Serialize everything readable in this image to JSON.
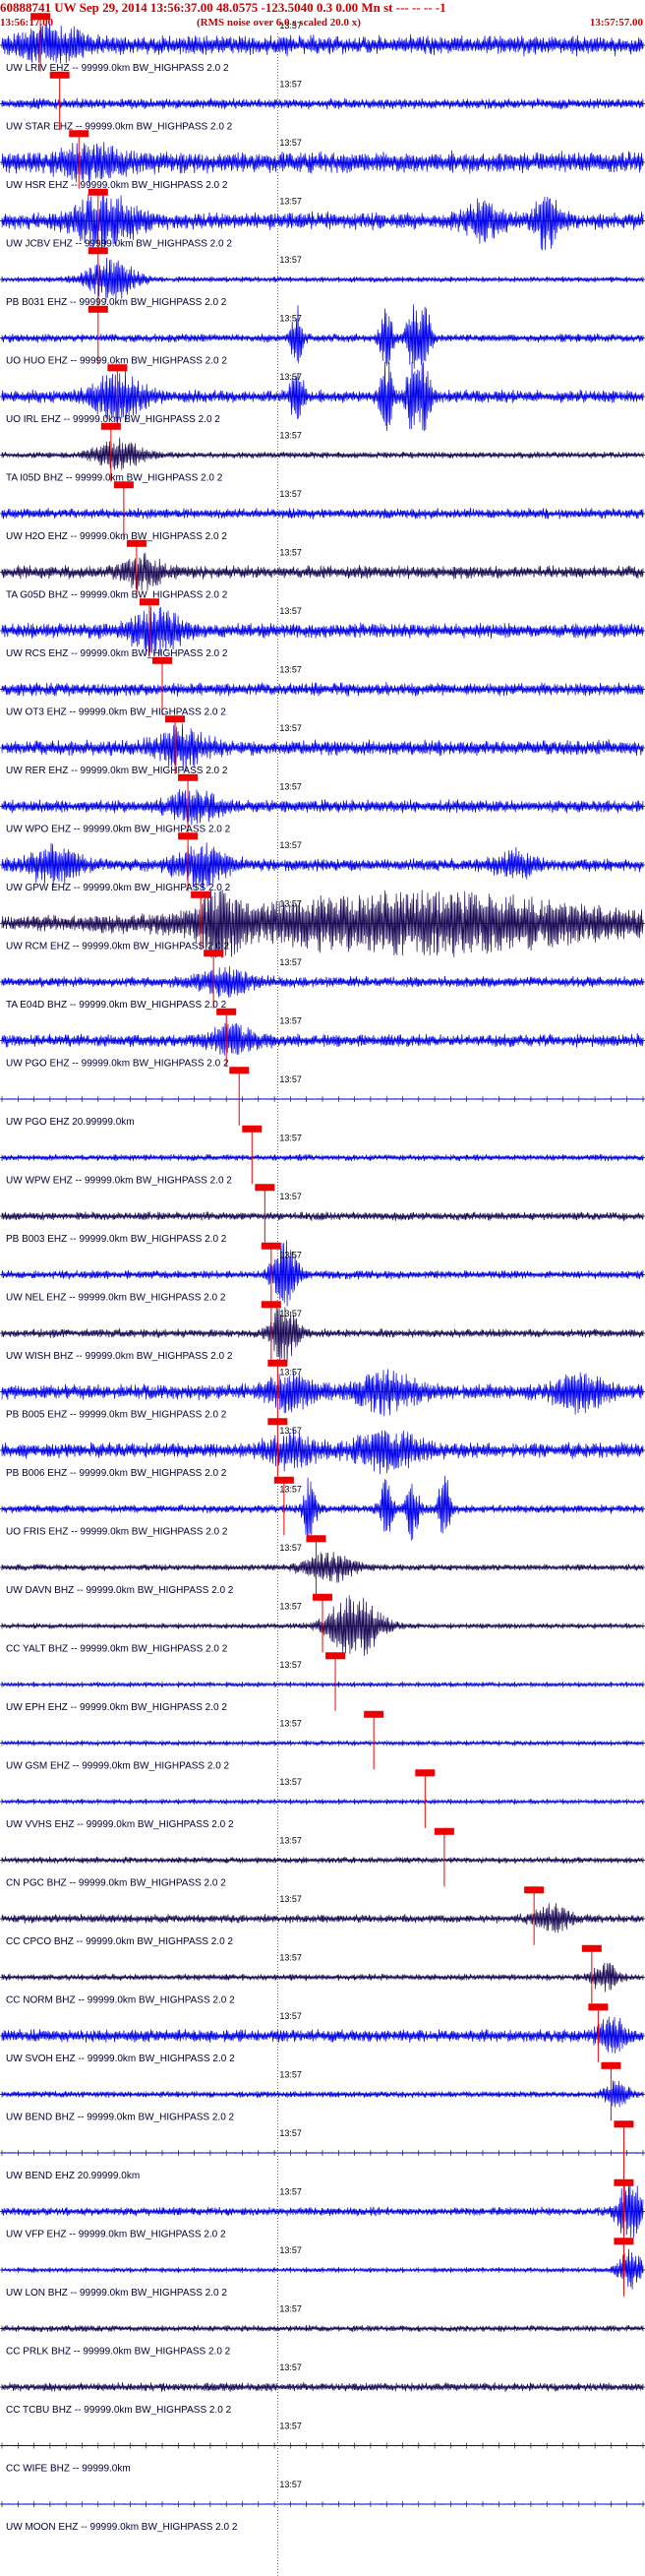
{
  "header": {
    "title": "60888741 UW Sep 29, 2014 13:56:37.00   48.0575 -123.5040  0.3 0.00 Mn st --- -- -- -1",
    "start_time": "13:56:17.00",
    "end_time": "13:57:57.00",
    "note": "(RMS noise over 6.0 s scaled 20.0 x)"
  },
  "colors": {
    "blue": "#0000ee",
    "dark": "#1a0a55",
    "red": "#ee0000"
  },
  "chart_data": {
    "type": "line",
    "title": "60888741 UW Sep 29, 2014 13:56:37.00   48.0575 -123.5040  0.3 0.00 Mn st --- -- -- -1",
    "x_start": "13:56:17.00",
    "x_end": "13:57:57.00",
    "minute_mark": "13:57",
    "traces": [
      {
        "label": "UW LRIV EHZ -- 99999.0km BW_HIGHPASS 2.0 2",
        "color": "blue",
        "amp": 0.45,
        "pick": 0.06,
        "events": [
          [
            0.08,
            0.6,
            0.05
          ]
        ]
      },
      {
        "label": "UW STAR EHZ -- 99999.0km BW_HIGHPASS 2.0 2",
        "color": "blue",
        "amp": 0.25,
        "pick": 0.09,
        "events": []
      },
      {
        "label": "UW HSR EHZ -- 99999.0km BW_HIGHPASS 2.0 2",
        "color": "blue",
        "amp": 0.5,
        "pick": 0.12,
        "events": [
          [
            0.14,
            0.5,
            0.05
          ]
        ]
      },
      {
        "label": "UW JCBV EHZ -- 99999.0km BW_HIGHPASS 2.0 2",
        "color": "blue",
        "amp": 0.4,
        "pick": 0.15,
        "events": [
          [
            0.16,
            0.9,
            0.05
          ],
          [
            0.75,
            0.7,
            0.03
          ],
          [
            0.85,
            1.0,
            0.02
          ]
        ]
      },
      {
        "label": "PB B031 EHZ -- 99999.0km BW_HIGHPASS 2.0 2",
        "color": "blue",
        "amp": 0.12,
        "pick": 0.15,
        "events": [
          [
            0.17,
            0.8,
            0.04
          ]
        ]
      },
      {
        "label": "UO HUO EHZ -- 99999.0km BW_HIGHPASS 2.0 2",
        "color": "blue",
        "amp": 0.2,
        "pick": 0.15,
        "events": [
          [
            0.46,
            1.2,
            0.01
          ],
          [
            0.6,
            1.2,
            0.01
          ],
          [
            0.64,
            1.2,
            0.01
          ],
          [
            0.66,
            1.2,
            0.01
          ]
        ]
      },
      {
        "label": "UO IRL EHZ -- 99999.0km BW_HIGHPASS 2.0 2",
        "color": "blue",
        "amp": 0.3,
        "pick": 0.18,
        "events": [
          [
            0.18,
            0.9,
            0.04
          ],
          [
            0.46,
            1.4,
            0.01
          ],
          [
            0.6,
            1.4,
            0.01
          ],
          [
            0.64,
            1.4,
            0.01
          ],
          [
            0.66,
            1.4,
            0.01
          ]
        ]
      },
      {
        "label": "TA I05D BHZ -- 99999.0km BW_HIGHPASS 2.0 2",
        "color": "dark",
        "amp": 0.15,
        "pick": 0.17,
        "events": [
          [
            0.18,
            0.6,
            0.04
          ]
        ]
      },
      {
        "label": "UW H2O EHZ -- 99999.0km BW_HIGHPASS 2.0 2",
        "color": "blue",
        "amp": 0.25,
        "pick": 0.19,
        "events": []
      },
      {
        "label": "TA G05D BHZ -- 99999.0km BW_HIGHPASS 2.0 2",
        "color": "dark",
        "amp": 0.3,
        "pick": 0.21,
        "events": [
          [
            0.22,
            0.6,
            0.03
          ]
        ]
      },
      {
        "label": "UW RCS EHZ -- 99999.0km BW_HIGHPASS 2.0 2",
        "color": "blue",
        "amp": 0.35,
        "pick": 0.23,
        "events": [
          [
            0.24,
            0.8,
            0.04
          ]
        ]
      },
      {
        "label": "UW OT3 EHZ -- 99999.0km BW_HIGHPASS 2.0 2",
        "color": "blue",
        "amp": 0.3,
        "pick": 0.25,
        "events": []
      },
      {
        "label": "UW RER EHZ -- 99999.0km BW_HIGHPASS 2.0 2",
        "color": "blue",
        "amp": 0.35,
        "pick": 0.27,
        "events": [
          [
            0.28,
            0.7,
            0.04
          ]
        ]
      },
      {
        "label": "UW WPO EHZ -- 99999.0km BW_HIGHPASS 2.0 2",
        "color": "blue",
        "amp": 0.3,
        "pick": 0.29,
        "events": [
          [
            0.3,
            0.6,
            0.04
          ]
        ]
      },
      {
        "label": "UW GPW EHZ -- 99999.0km BW_HIGHPASS 2.0 2",
        "color": "blue",
        "amp": 0.3,
        "pick": 0.29,
        "events": [
          [
            0.31,
            0.8,
            0.04
          ],
          [
            0.08,
            0.7,
            0.04
          ],
          [
            0.8,
            0.5,
            0.03
          ]
        ]
      },
      {
        "label": "UW RCM EHZ -- 99999.0km BW_HIGHPASS 2.0 2",
        "color": "dark",
        "amp": 0.35,
        "pick": 0.31,
        "events": [
          [
            0.34,
            1.2,
            0.03
          ],
          [
            0.65,
            1.1,
            0.3
          ]
        ]
      },
      {
        "label": "TA E04D BHZ -- 99999.0km BW_HIGHPASS 2.0 2",
        "color": "blue",
        "amp": 0.25,
        "pick": 0.33,
        "events": [
          [
            0.35,
            0.5,
            0.04
          ]
        ]
      },
      {
        "label": "UW PGO EHZ -- 99999.0km BW_HIGHPASS 2.0 2",
        "color": "blue",
        "amp": 0.3,
        "pick": 0.35,
        "events": [
          [
            0.36,
            0.5,
            0.04
          ]
        ]
      },
      {
        "label": "UW PGO EHZ 20.99999.0km",
        "color": "blue",
        "amp": 0.02,
        "pick": 0.37,
        "events": []
      },
      {
        "label": "UW WPW EHZ -- 99999.0km BW_HIGHPASS 2.0 2",
        "color": "blue",
        "amp": 0.15,
        "pick": 0.39,
        "events": []
      },
      {
        "label": "PB B003 EHZ -- 99999.0km BW_HIGHPASS 2.0 2",
        "color": "dark",
        "amp": 0.2,
        "pick": 0.41,
        "events": []
      },
      {
        "label": "UW NEL EHZ -- 99999.0km BW_HIGHPASS 2.0 2",
        "color": "blue",
        "amp": 0.2,
        "pick": 0.42,
        "events": [
          [
            0.44,
            1.3,
            0.02
          ]
        ]
      },
      {
        "label": "UW WISH BHZ -- 99999.0km BW_HIGHPASS 2.0 2",
        "color": "dark",
        "amp": 0.2,
        "pick": 0.42,
        "events": [
          [
            0.44,
            1.3,
            0.02
          ]
        ]
      },
      {
        "label": "PB B005 EHZ -- 99999.0km BW_HIGHPASS 2.0 2",
        "color": "blue",
        "amp": 0.35,
        "pick": 0.43,
        "events": [
          [
            0.45,
            0.6,
            0.04
          ],
          [
            0.6,
            0.7,
            0.05
          ],
          [
            0.9,
            0.6,
            0.04
          ]
        ]
      },
      {
        "label": "PB B006 EHZ -- 99999.0km BW_HIGHPASS 2.0 2",
        "color": "blue",
        "amp": 0.35,
        "pick": 0.43,
        "events": [
          [
            0.45,
            0.6,
            0.04
          ],
          [
            0.6,
            0.7,
            0.05
          ]
        ]
      },
      {
        "label": "UO FRIS EHZ -- 99999.0km BW_HIGHPASS 2.0 2",
        "color": "blue",
        "amp": 0.2,
        "pick": 0.44,
        "events": [
          [
            0.48,
            1.3,
            0.01
          ],
          [
            0.6,
            1.3,
            0.01
          ],
          [
            0.64,
            1.3,
            0.01
          ],
          [
            0.69,
            1.3,
            0.01
          ]
        ]
      },
      {
        "label": "UW DAVN BHZ -- 99999.0km BW_HIGHPASS 2.0 2",
        "color": "dark",
        "amp": 0.15,
        "pick": 0.49,
        "events": [
          [
            0.51,
            0.6,
            0.04
          ]
        ]
      },
      {
        "label": "CC YALT BHZ -- 99999.0km BW_HIGHPASS 2.0 2",
        "color": "dark",
        "amp": 0.12,
        "pick": 0.5,
        "events": [
          [
            0.55,
            1.4,
            0.04
          ]
        ]
      },
      {
        "label": "UW EPH EHZ -- 99999.0km BW_HIGHPASS 2.0 2",
        "color": "blue",
        "amp": 0.1,
        "pick": 0.52,
        "events": []
      },
      {
        "label": "UW GSM EHZ -- 99999.0km BW_HIGHPASS 2.0 2",
        "color": "blue",
        "amp": 0.1,
        "pick": 0.58,
        "events": []
      },
      {
        "label": "UW VVHS EHZ -- 99999.0km BW_HIGHPASS 2.0 2",
        "color": "blue",
        "amp": 0.1,
        "pick": 0.66,
        "events": []
      },
      {
        "label": "CN PGC BHZ -- 99999.0km BW_HIGHPASS 2.0 2",
        "color": "dark",
        "amp": 0.15,
        "pick": 0.69,
        "events": []
      },
      {
        "label": "CC CPCO BHZ -- 99999.0km BW_HIGHPASS 2.0 2",
        "color": "dark",
        "amp": 0.2,
        "pick": 0.83,
        "events": [
          [
            0.86,
            0.5,
            0.03
          ]
        ]
      },
      {
        "label": "CC NORM BHZ -- 99999.0km BW_HIGHPASS 2.0 2",
        "color": "dark",
        "amp": 0.15,
        "pick": 0.92,
        "events": [
          [
            0.94,
            0.6,
            0.02
          ]
        ]
      },
      {
        "label": "UW SVOH EHZ -- 99999.0km BW_HIGHPASS 2.0 2",
        "color": "blue",
        "amp": 0.3,
        "pick": 0.93,
        "events": [
          [
            0.95,
            0.8,
            0.02
          ]
        ]
      },
      {
        "label": "UW BEND BHZ -- 99999.0km BW_HIGHPASS 2.0 2",
        "color": "blue",
        "amp": 0.15,
        "pick": 0.95,
        "events": [
          [
            0.96,
            0.5,
            0.02
          ]
        ]
      },
      {
        "label": "UW BEND EHZ 20.99999.0km",
        "color": "blue",
        "amp": 0.02,
        "pick": 0.97,
        "events": []
      },
      {
        "label": "UW VFP EHZ -- 99999.0km BW_HIGHPASS 2.0 2",
        "color": "blue",
        "amp": 0.2,
        "pick": 0.97,
        "events": [
          [
            0.98,
            1.3,
            0.02
          ]
        ]
      },
      {
        "label": "UW LON BHZ -- 99999.0km BW_HIGHPASS 2.0 2",
        "color": "blue",
        "amp": 0.1,
        "pick": 0.97,
        "events": [
          [
            0.98,
            0.8,
            0.02
          ]
        ]
      },
      {
        "label": "CC PRLK BHZ -- 99999.0km BW_HIGHPASS 2.0 2",
        "color": "dark",
        "amp": 0.15,
        "pick": 1.1,
        "events": []
      },
      {
        "label": "CC TCBU BHZ -- 99999.0km BW_HIGHPASS 2.0 2",
        "color": "dark",
        "amp": 0.2,
        "pick": 1.1,
        "events": []
      },
      {
        "label": "CC WIFE BHZ -- 99999.0km",
        "color": "dark",
        "amp": 0.02,
        "pick": 1.1,
        "events": []
      },
      {
        "label": "UW MOON EHZ -- 99999.0km BW_HIGHPASS 2.0 2",
        "color": "blue",
        "amp": 0.02,
        "pick": 1.1,
        "events": []
      }
    ]
  }
}
